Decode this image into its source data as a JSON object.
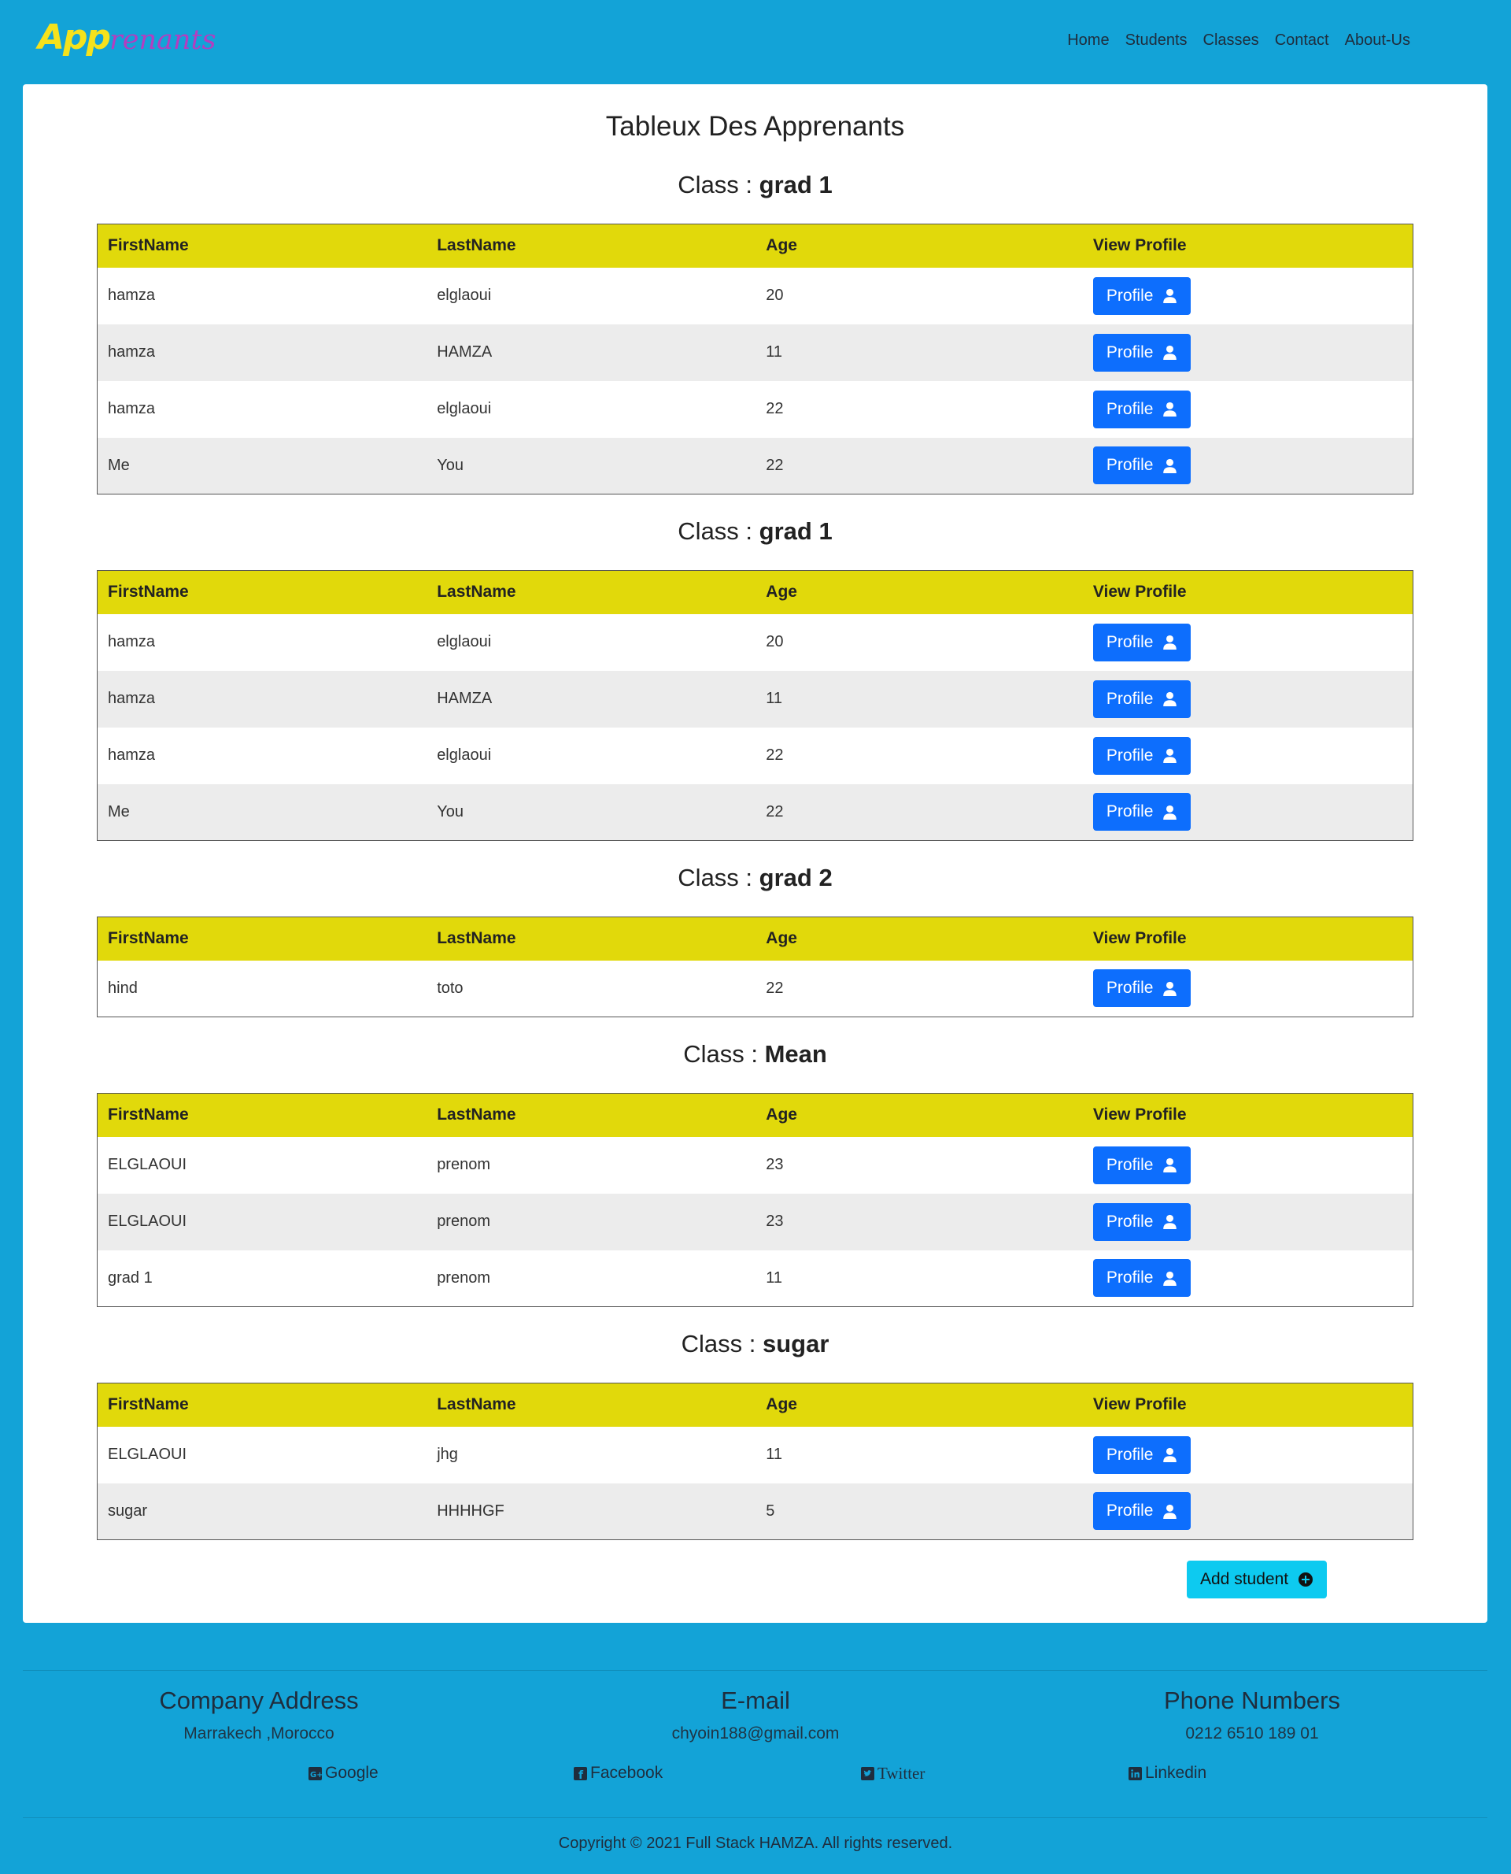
{
  "brand": {
    "part1": "App",
    "part2": "renants"
  },
  "nav": [
    "Home",
    "Students",
    "Classes",
    "Contact",
    "About-Us"
  ],
  "page_title": "Tableux Des Apprenants",
  "class_prefix": "Class :",
  "headers": [
    "FirstName",
    "LastName",
    "Age",
    "View Profile"
  ],
  "profile_label": "Profile",
  "add_label": "Add student",
  "classes": [
    {
      "name": "grad 1",
      "rows": [
        [
          "hamza",
          "elglaoui",
          "20"
        ],
        [
          "hamza",
          "HAMZA",
          "11"
        ],
        [
          "hamza",
          "elglaoui",
          "22"
        ],
        [
          "Me",
          "You",
          "22"
        ]
      ]
    },
    {
      "name": "grad 1",
      "rows": [
        [
          "hamza",
          "elglaoui",
          "20"
        ],
        [
          "hamza",
          "HAMZA",
          "11"
        ],
        [
          "hamza",
          "elglaoui",
          "22"
        ],
        [
          "Me",
          "You",
          "22"
        ]
      ]
    },
    {
      "name": "grad 2",
      "rows": [
        [
          "hind",
          "toto",
          "22"
        ]
      ]
    },
    {
      "name": "Mean",
      "rows": [
        [
          "ELGLAOUI",
          "prenom",
          "23"
        ],
        [
          "ELGLAOUI",
          "prenom",
          "23"
        ],
        [
          "grad 1",
          "prenom",
          "11"
        ]
      ]
    },
    {
      "name": "sugar",
      "rows": [
        [
          "ELGLAOUI",
          "jhg",
          "11"
        ],
        [
          "sugar",
          "HHHHGF",
          "5"
        ]
      ]
    }
  ],
  "footer": {
    "address_title": "Company Address",
    "address": "Marrakech ,Morocco",
    "email_title": "E-mail",
    "email": "chyoin188@gmail.com",
    "phone_title": "Phone Numbers",
    "phone": "0212 6510 189 01",
    "social": [
      "Google",
      "Facebook",
      "Twitter",
      "Linkedin"
    ],
    "copyright": "Copyright © 2021 Full Stack HAMZA. All rights reserved."
  },
  "colors": {
    "background": "#13a3d7",
    "table_header": "#e1d90b",
    "profile_button": "#0d6efd",
    "add_button": "#0dcaf0",
    "logo_app": "#f5e21c",
    "logo_renants": "#b33ec0"
  },
  "icons": {
    "profile": "user-icon",
    "add": "plus-circle-icon"
  }
}
